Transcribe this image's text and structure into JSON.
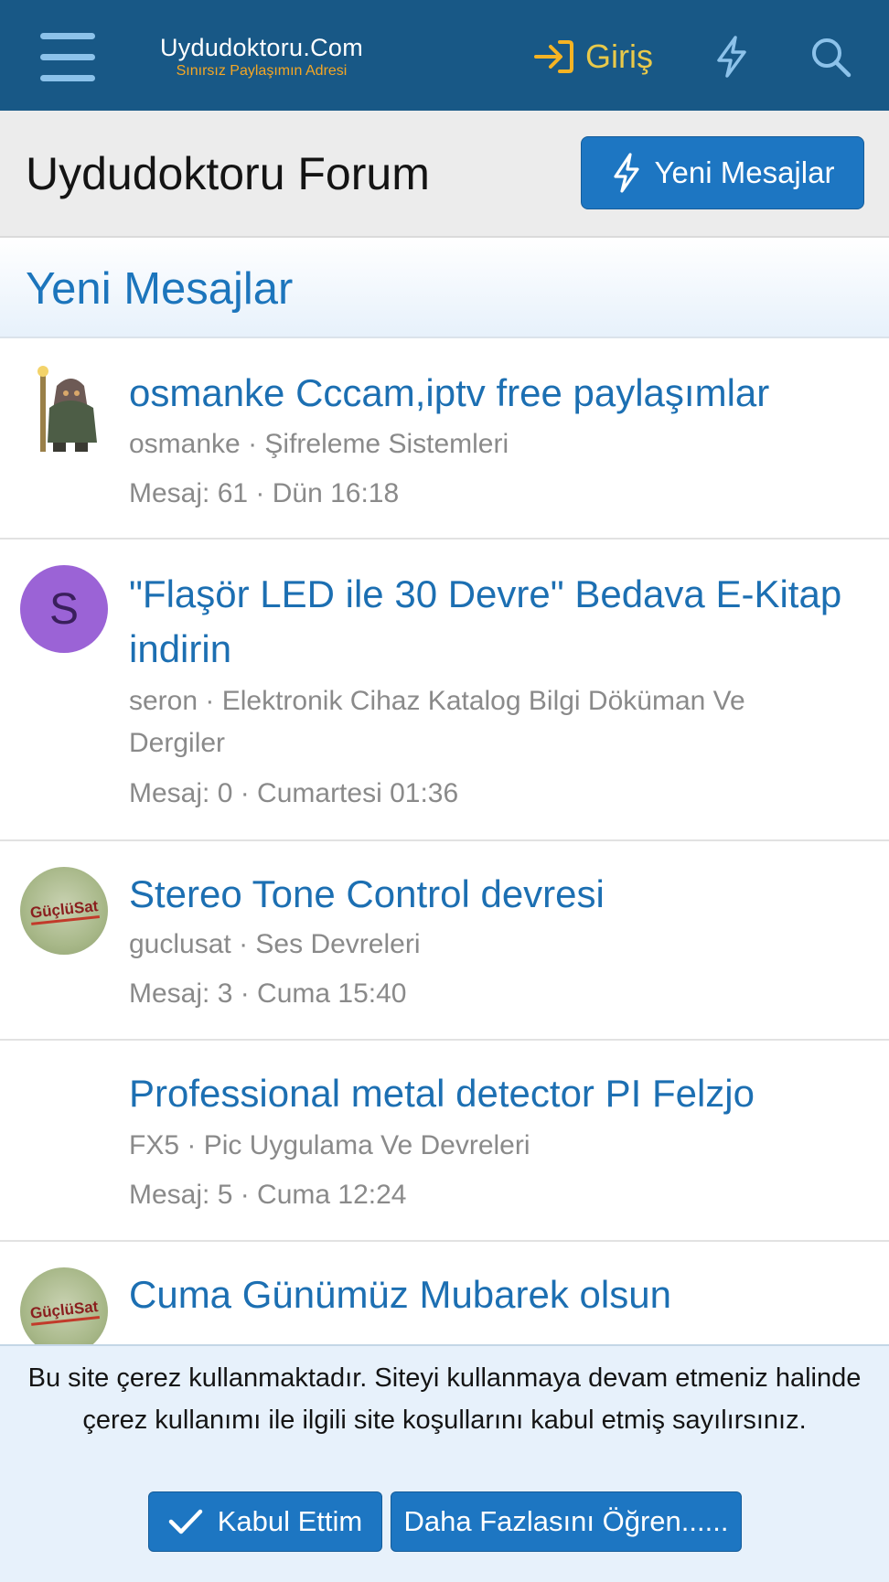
{
  "header": {
    "logo_title": "Uydudoktoru.Com",
    "logo_subtitle": "Sınırsız Paylaşımın Adresi",
    "login_label": "Giriş",
    "icons": [
      "menu-icon",
      "login-icon",
      "bolt-icon",
      "search-icon"
    ]
  },
  "page": {
    "title": "Uydudoktoru Forum",
    "new_posts_button": "Yeni Mesajlar"
  },
  "section": {
    "title": "Yeni Mesajlar"
  },
  "threads": [
    {
      "title": "osmanke Cccam,iptv free paylaşımlar",
      "user": "osmanke",
      "forum": "Şifreleme Sistemleri",
      "stats": "Mesaj: 61 · Dün 16:18",
      "avatar": "character-figure"
    },
    {
      "title": "\"Flaşör LED ile 30 Devre\" Bedava E-Kitap indirin",
      "user": "seron",
      "forum": "Elektronik Cihaz Katalog Bilgi Döküman Ve Dergiler",
      "stats": "Mesaj: 0 · Cumartesi 01:36",
      "avatar_letter": "S"
    },
    {
      "title": "Stereo Tone Control devresi",
      "user": "guclusat",
      "forum": "Ses Devreleri",
      "stats": "Mesaj: 3 · Cuma 15:40",
      "avatar_text": "GüçlüSat"
    },
    {
      "title": "Professional metal detector PI Felzjo",
      "user": "FX5",
      "forum": "Pic Uygulama Ve Devreleri",
      "stats": "Mesaj: 5 · Cuma 12:24"
    },
    {
      "title": "Cuma Günümüz Mubarek olsun",
      "avatar_text": "GüçlüSat"
    }
  ],
  "cookie": {
    "text": "Bu site çerez kullanmaktadır. Siteyi kullanmaya devam etmeniz halinde çerez kullanımı ile ilgili site koşullarını kabul etmiş sayılırsınız.",
    "accept_label": "Kabul Ettim",
    "learn_more_label": "Daha Fazlasını Öğren......"
  },
  "colors": {
    "header_bg": "#185886",
    "accent": "#1d76c2",
    "link": "#1c6fb2",
    "login_icon": "#f5b323",
    "avatar_s_bg": "#9b63d6"
  }
}
